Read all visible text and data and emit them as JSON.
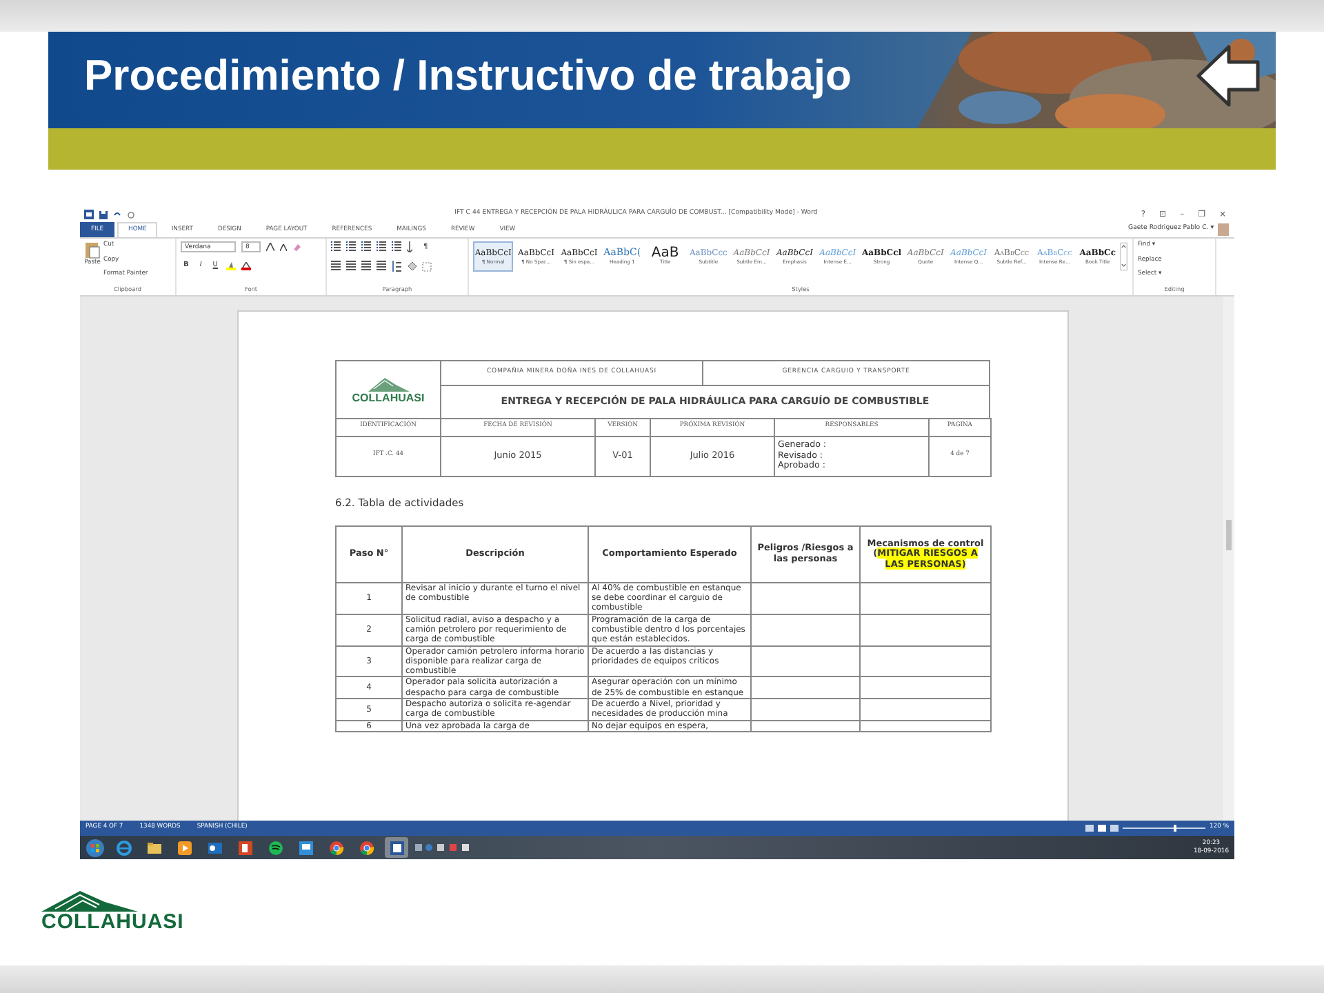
{
  "slide": {
    "title": "Procedimiento / Instructivo de trabajo",
    "footer_logo": "COLLAHUASI"
  },
  "word": {
    "title": "IFT C 44 ENTREGA Y RECEPCIÓN DE PALA HIDRÁULICA PARA CARGUÍO DE COMBUST... [Compatibility Mode] - Word",
    "window_buttons": [
      "?",
      "⊡",
      "–",
      "❐",
      "×"
    ],
    "user": "Gaete Rodriguez Pablo C. ▾",
    "tabs": [
      {
        "label": "FILE",
        "kind": "file",
        "selected": false
      },
      {
        "label": "HOME",
        "kind": "tab",
        "selected": true
      },
      {
        "label": "INSERT",
        "kind": "tab",
        "selected": false
      },
      {
        "label": "DESIGN",
        "kind": "tab",
        "selected": false
      },
      {
        "label": "PAGE LAYOUT",
        "kind": "tab",
        "selected": false
      },
      {
        "label": "REFERENCES",
        "kind": "tab",
        "selected": false
      },
      {
        "label": "MAILINGS",
        "kind": "tab",
        "selected": false
      },
      {
        "label": "REVIEW",
        "kind": "tab",
        "selected": false
      },
      {
        "label": "VIEW",
        "kind": "tab",
        "selected": false
      }
    ],
    "clipboard": {
      "label": "Clipboard",
      "paste": "Paste",
      "items": [
        "Cut",
        "Copy",
        "Format Painter"
      ]
    },
    "font": {
      "label": "Font",
      "family": "Verdana",
      "size": "8",
      "format_buttons": [
        "B",
        "I",
        "U"
      ]
    },
    "paragraph": {
      "label": "Paragraph",
      "mark": "¶"
    },
    "styles": {
      "label": "Styles",
      "items": [
        {
          "sample": "AaBbCcI",
          "name": "¶ Normal",
          "kind": "normal",
          "selected": true
        },
        {
          "sample": "AaBbCcI",
          "name": "¶ No Spac...",
          "kind": "normal",
          "selected": false
        },
        {
          "sample": "AaBbCcI",
          "name": "¶ Sin espa...",
          "kind": "normal",
          "selected": false
        },
        {
          "sample": "AaBbC(",
          "name": "Heading 1",
          "kind": "heading",
          "selected": false
        },
        {
          "sample": "AaB",
          "name": "Title",
          "kind": "title",
          "selected": false
        },
        {
          "sample": "AaBbCcc",
          "name": "Subtitle",
          "kind": "subtitle",
          "selected": false
        },
        {
          "sample": "AaBbCcI",
          "name": "Subtle Em...",
          "kind": "subtle",
          "selected": false
        },
        {
          "sample": "AaBbCcI",
          "name": "Emphasis",
          "kind": "emphasis",
          "selected": false
        },
        {
          "sample": "AaBbCcI",
          "name": "Intense E...",
          "kind": "intense",
          "selected": false
        },
        {
          "sample": "AaBbCcl",
          "name": "Strong",
          "kind": "strong",
          "selected": false
        },
        {
          "sample": "AaBbCcI",
          "name": "Quote",
          "kind": "subtle",
          "selected": false
        },
        {
          "sample": "AaBbCcI",
          "name": "Intense Q...",
          "kind": "intense",
          "selected": false
        },
        {
          "sample": "AaBbCcc",
          "name": "Subtle Ref...",
          "kind": "smallcaps",
          "selected": false
        },
        {
          "sample": "AaBbCcc",
          "name": "Intense Re...",
          "kind": "intensecaps",
          "selected": false
        },
        {
          "sample": "AaBbCc",
          "name": "Book Title",
          "kind": "strong",
          "selected": false
        }
      ]
    },
    "editing": {
      "label": "Editing",
      "items": [
        "Find ▾",
        "Replace",
        "Select ▾"
      ]
    },
    "document": {
      "header": {
        "logo": "COLLAHUASI",
        "company": "COMPAÑIA MINERA DOÑA INES DE COLLAHUASI",
        "department": "GERENCIA CARGUIO Y TRANSPORTE",
        "title": "ENTREGA Y RECEPCIÓN DE PALA HIDRÁULICA PARA CARGUÍO DE COMBUSTIBLE",
        "columns": [
          "IDENTIFICACIÓN",
          "FECHA DE REVISIÓN",
          "VERSIÓN",
          "PRÓXIMA REVISIÓN",
          "RESPONSABLES",
          "PAGINA"
        ],
        "values": [
          "IFT .C. 44",
          "Junio 2015",
          "V-01",
          "Julio 2016",
          "Generado :\nRevisado  :\nAprobado :",
          "4 de 7"
        ]
      },
      "section_title": "6.2. Tabla de actividades",
      "table": {
        "columns": [
          {
            "label": "Paso N°"
          },
          {
            "label": "Descripción"
          },
          {
            "label": "Comportamiento Esperado"
          },
          {
            "label": "Peligros /Riesgos a las personas"
          },
          {
            "label": "Mecanismos de control (",
            "highlight": "MITIGAR RIESGOS A LAS PERSONAS)"
          }
        ],
        "rows": [
          [
            "1",
            "Revisar al inicio y durante el turno el nivel de combustible",
            "Al 40% de combustible en estanque se debe coordinar el carguio de combustible"
          ],
          [
            "2",
            "Solicitud radial, aviso a despacho y a camión petrolero por requerimiento de carga de combustible",
            "Programación de la carga de combustible dentro d los porcentajes que están establecidos."
          ],
          [
            "3",
            "Operador camión petrolero informa horario disponible para realizar carga de combustible",
            "De acuerdo a las distancias y prioridades de equipos críticos"
          ],
          [
            "4",
            "Operador pala solicita autorización a despacho para carga de combustible",
            "Asegurar operación con un mínimo de 25% de combustible en estanque"
          ],
          [
            "5",
            "Despacho autoriza o solicita re-agendar carga de combustible",
            "De acuerdo a Nivel, prioridad y necesidades de producción mina"
          ],
          [
            "6",
            "Una vez aprobada la carga de",
            "No dejar equipos en espera,"
          ]
        ]
      }
    },
    "status": {
      "items": [
        "PAGE 4 OF 7",
        "1348 WORDS",
        "SPANISH (CHILE)"
      ],
      "zoom": "120 %",
      "level": 0.62
    }
  },
  "taskbar": {
    "apps": [
      {
        "kind": "browser",
        "selected": false
      },
      {
        "kind": "folder",
        "selected": false
      },
      {
        "kind": "media",
        "selected": false
      },
      {
        "kind": "mail",
        "selected": false
      },
      {
        "kind": "slides",
        "selected": false
      },
      {
        "kind": "music",
        "selected": false
      },
      {
        "kind": "chat",
        "selected": false
      },
      {
        "kind": "chrome",
        "selected": false
      },
      {
        "kind": "chrome",
        "selected": false
      },
      {
        "kind": "word",
        "selected": true
      }
    ],
    "time": "20:23",
    "date": "18-09-2016"
  }
}
